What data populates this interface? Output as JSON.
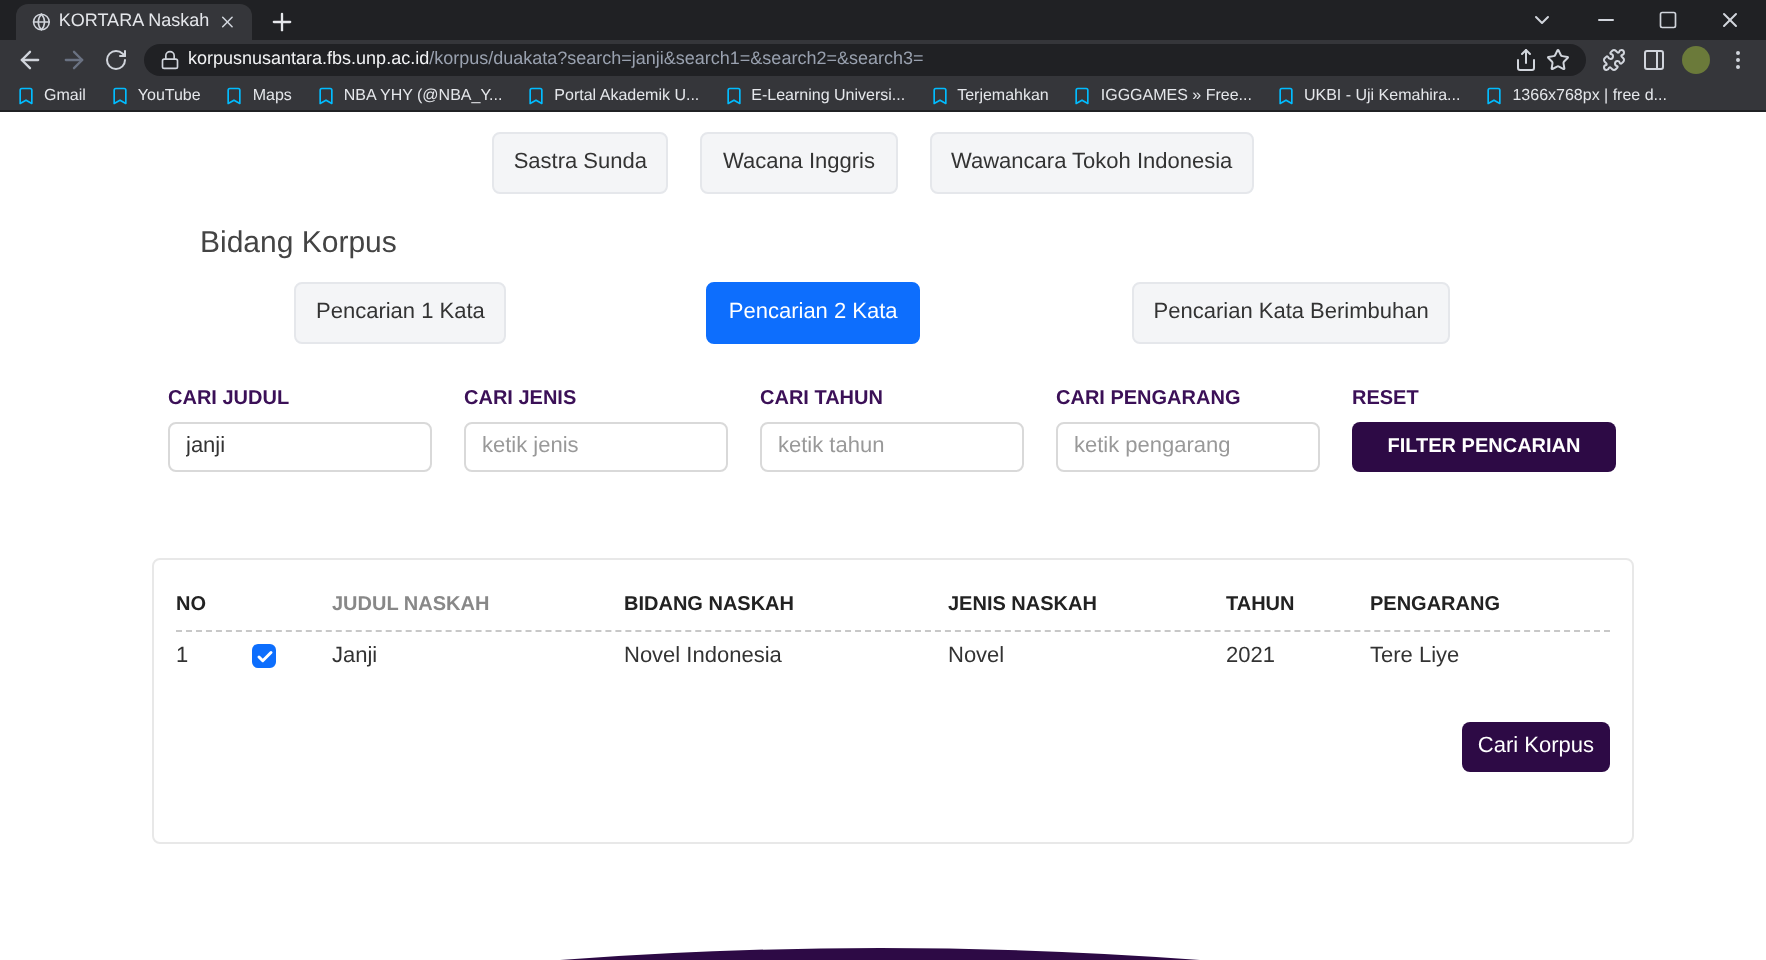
{
  "browser": {
    "tab_title": "KORTARA Naskah",
    "url_host": "korpusnusantara.fbs.unp.ac.id",
    "url_path": "/korpus/duakata?search=janji&search1=&search2=&search3=",
    "bookmarks": [
      "Gmail",
      "YouTube",
      "Maps",
      "NBA YHY (@NBA_Y...",
      "Portal Akademik U...",
      "E-Learning Universi...",
      "Terjemahkan",
      "IGGGAMES » Free...",
      "UKBI - Uji Kemahira...",
      "1366x768px | free d..."
    ]
  },
  "corpus_buttons": [
    "Sastra Sunda",
    "Wacana Inggris",
    "Wawancara Tokoh Indonesia"
  ],
  "section_title": "Bidang Korpus",
  "search_modes": [
    {
      "label": "Pencarian 1 Kata",
      "selected": false
    },
    {
      "label": "Pencarian 2 Kata",
      "selected": true
    },
    {
      "label": "Pencarian Kata Berimbuhan",
      "selected": false
    }
  ],
  "filters": [
    {
      "label": "CARI JUDUL",
      "value": "janji"
    },
    {
      "label": "CARI JENIS",
      "placeholder": "ketik jenis"
    },
    {
      "label": "CARI TAHUN",
      "placeholder": "ketik tahun"
    },
    {
      "label": "CARI PENGARANG",
      "placeholder": "ketik pengarang"
    }
  ],
  "reset": {
    "label": "RESET",
    "button": "FILTER PENCARIAN"
  },
  "table": {
    "columns": [
      {
        "kind": "text",
        "label": "NO",
        "dimmed": false
      },
      {
        "kind": "checkbox"
      },
      {
        "kind": "text",
        "label": "JUDUL NASKAH",
        "dimmed": true
      },
      {
        "kind": "text",
        "label": "BIDANG NASKAH",
        "dimmed": false
      },
      {
        "kind": "text",
        "label": "JENIS NASKAH",
        "dimmed": false
      },
      {
        "kind": "text",
        "label": "TAHUN",
        "dimmed": false
      },
      {
        "kind": "text",
        "label": "PENGARANG",
        "dimmed": false
      }
    ],
    "rows": [
      {
        "checked": true,
        "cells": [
          "1",
          "",
          "Janji",
          "Novel Indonesia",
          "Novel",
          "2021",
          "Tere Liye"
        ]
      }
    ]
  },
  "search_button": "Cari Korpus"
}
